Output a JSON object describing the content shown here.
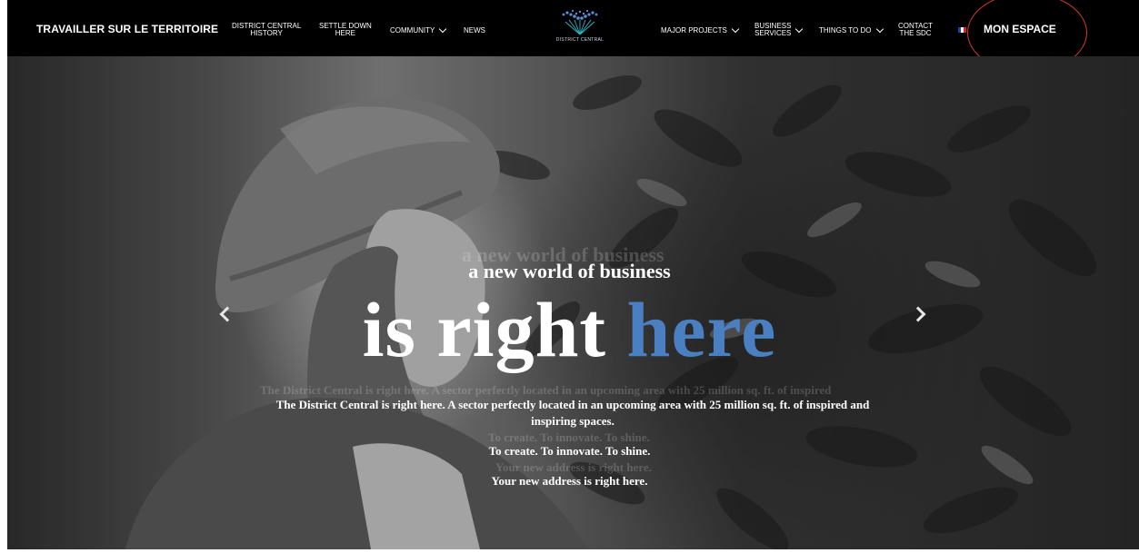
{
  "nav": {
    "brand": "TRAVAILLER SUR LE TERRITOIRE",
    "left_items": [
      {
        "line1": "DISTRICT CENTRAL",
        "line2": "HISTORY"
      },
      {
        "line1": "SETTLE DOWN",
        "line2": "HERE"
      },
      {
        "label": "COMMUNITY"
      },
      {
        "label": "NEWS"
      }
    ],
    "logo_text": "DISTRICT CENTRAL",
    "right_items": [
      {
        "label": "MAJOR PROJECTS"
      },
      {
        "line1": "BUSINESS",
        "line2": "SERVICES"
      },
      {
        "label": "THINGS TO DO"
      },
      {
        "line1": "CONTACT",
        "line2": "THE SDC"
      }
    ],
    "mon_espace": "MON ESPACE",
    "flag_colors": [
      "#1f3fa8",
      "#ffffff",
      "#d9212b"
    ]
  },
  "hero": {
    "tagline": "a new world of business",
    "headline_white": "is right",
    "headline_blue": "here",
    "description": "The District Central is right here. A sector perfectly located in an upcoming area with 25 million sq. ft. of inspired and inspiring spaces.",
    "line_create": "To create. To innovate. To shine.",
    "line_address": "Your new address is right here.",
    "ghost_tagline": "a new world of business",
    "ghost_description": "The District Central is right here. A sector perfectly located in an upcoming area with 25 million sq. ft. of inspired",
    "ghost_create": "To create. To innovate. To shine.",
    "ghost_address": "Your new address is right here.",
    "accent_color": "#4a7fc1"
  }
}
